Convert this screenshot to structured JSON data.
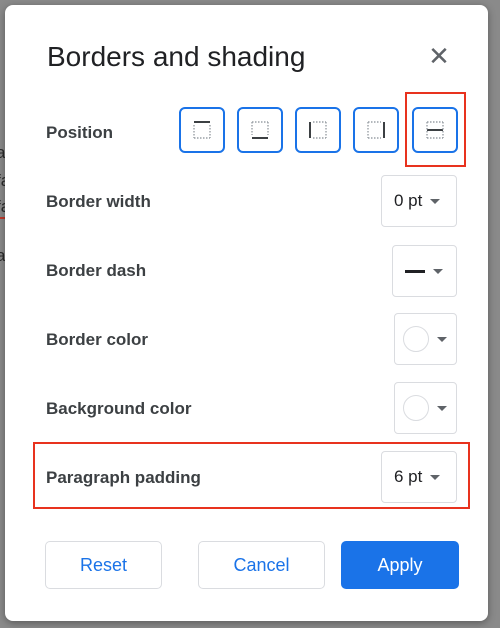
{
  "background_doc": {
    "fragments": [
      "ag",
      "fa",
      "fa",
      "ag"
    ]
  },
  "dialog": {
    "title": "Borders and shading",
    "close_icon": "close-icon",
    "rows": {
      "position": {
        "label": "Position",
        "options": [
          "border-top-icon",
          "border-bottom-icon",
          "border-left-icon",
          "border-right-icon",
          "border-between-icon"
        ],
        "highlighted_index": 4
      },
      "border_width": {
        "label": "Border width",
        "value": "0 pt"
      },
      "border_dash": {
        "label": "Border dash",
        "value_icon": "solid-line-icon"
      },
      "border_color": {
        "label": "Border color",
        "value_color": "#ffffff"
      },
      "background_color": {
        "label": "Background color",
        "value_color": "#ffffff"
      },
      "paragraph_padding": {
        "label": "Paragraph padding",
        "value": "6 pt",
        "highlighted": true
      }
    },
    "buttons": {
      "reset": "Reset",
      "cancel": "Cancel",
      "apply": "Apply"
    },
    "colors": {
      "accent": "#1a73e8",
      "highlight": "#e8321e"
    }
  }
}
